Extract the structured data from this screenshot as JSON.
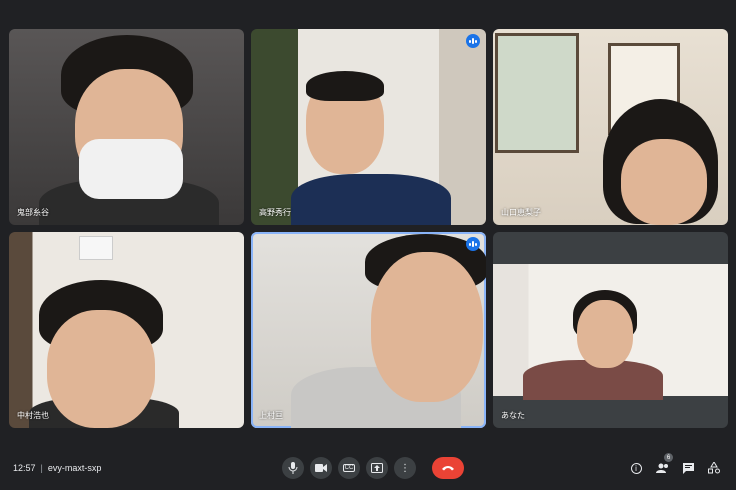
{
  "participants": [
    {
      "name": "鬼部糸谷"
    },
    {
      "name": "高野秀行"
    },
    {
      "name": "山口恵梨子"
    },
    {
      "name": "中村浩也"
    },
    {
      "name": "上村亘"
    },
    {
      "name": "あなた"
    }
  ],
  "meeting": {
    "time": "12:57",
    "separator": "|",
    "code": "evy-maxt-sxp"
  },
  "controls": {
    "mic": "mic-icon",
    "camera": "camera-icon",
    "captions": "CC",
    "present": "present-icon",
    "more": "⋮",
    "end": "end-call-icon"
  },
  "right_actions": {
    "info": "i",
    "people_count": "6",
    "people": "people-icon",
    "chat": "chat-icon",
    "activities": "activities-icon"
  },
  "colors": {
    "background": "#202124",
    "tile": "#3c4043",
    "accent": "#1a73e8",
    "end": "#ea4335"
  }
}
